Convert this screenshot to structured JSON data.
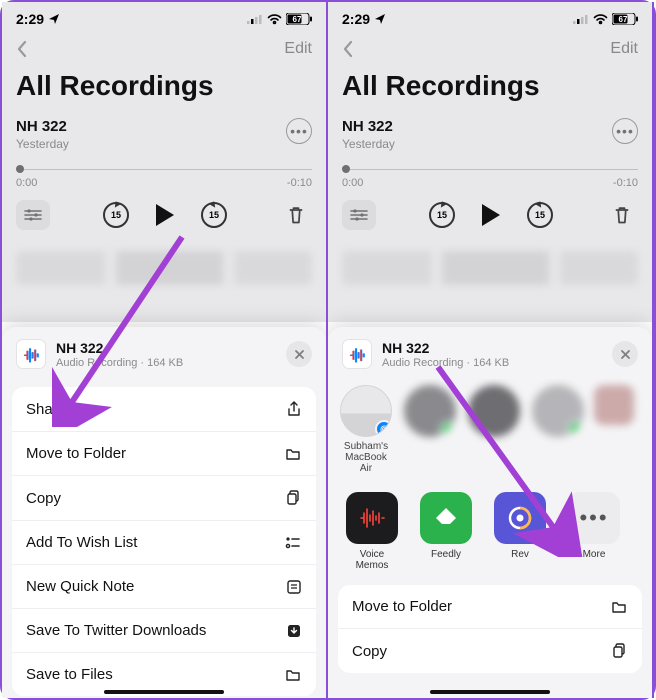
{
  "statusbar": {
    "time": "2:29",
    "battery": "67"
  },
  "nav": {
    "edit": "Edit"
  },
  "page": {
    "title": "All Recordings"
  },
  "recording": {
    "name": "NH 322",
    "date": "Yesterday",
    "elapsed": "0:00",
    "remaining": "-0:10",
    "skip": "15"
  },
  "sheet": {
    "title": "NH 322",
    "subtitle": "Audio Recording · 164 KB"
  },
  "menu1": [
    {
      "label": "Share",
      "icon": "share"
    },
    {
      "label": "Move to Folder",
      "icon": "folder"
    },
    {
      "label": "Copy",
      "icon": "copy"
    },
    {
      "label": "Add To Wish List",
      "icon": "list"
    },
    {
      "label": "New Quick Note",
      "icon": "note"
    },
    {
      "label": "Save To Twitter Downloads",
      "icon": "download"
    },
    {
      "label": "Save to Files",
      "icon": "folder"
    }
  ],
  "airdrop": {
    "mac_label": "Subham's MacBook Air"
  },
  "apps": [
    {
      "label": "Voice Memos"
    },
    {
      "label": "Feedly"
    },
    {
      "label": "Rev"
    },
    {
      "label": "More"
    }
  ],
  "menu2": [
    {
      "label": "Move to Folder",
      "icon": "folder"
    },
    {
      "label": "Copy",
      "icon": "copy"
    }
  ],
  "colors": {
    "arrow": "#a23fd4"
  }
}
